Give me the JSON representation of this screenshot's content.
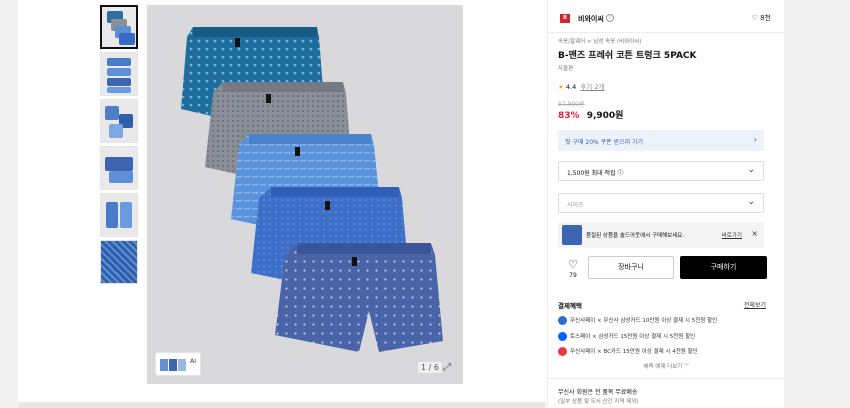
{
  "gallery": {
    "counter": "1 / 6",
    "ai_label": "AI"
  },
  "brand": {
    "logo_text": "B",
    "name": "비와이씨",
    "follow_count": "8천"
  },
  "product": {
    "breadcrumb": "속옷/홈웨어 > 남성 속옷 (비와이씨)",
    "title": "B-맨즈 프레쉬 코튼 트렁크 5PACK",
    "subtitle": "자율편",
    "rating": "4.4",
    "review_count": "후기 2개",
    "original_price": "57,900원",
    "discount": "83%",
    "price": "9,900원"
  },
  "coupon": {
    "text": "첫 구매 20% 쿠폰 받으러 가기"
  },
  "points_select": {
    "value": "1,500원 최대 적립 ⓘ"
  },
  "size_select": {
    "placeholder": "사이즈"
  },
  "banner": {
    "text": "품절된 상품을 솔드아웃에서 구매해보세요.",
    "link": "바로가기"
  },
  "actions": {
    "like_count": "79",
    "cart_label": "장바구니",
    "buy_label": "구매하기"
  },
  "payment": {
    "title": "결제혜택",
    "view_all": "전체보기",
    "rows": [
      "무신사페이 × 무신사 삼성카드 10만원 이상 결제 시 5천원 할인",
      "토스페이 × 삼성카드 15만원 이상 결제 시 5천원 할인",
      "무신사페이 × BC카드 15만원 이상 결제 시 4천원 할인"
    ],
    "more": "혜택 예제 더보기 ﹀"
  },
  "shipping": {
    "line1": "무신사 회원은 전 품목 무료배송",
    "line2": "(일부 상품 및 도서 산간 지역 제외)"
  },
  "colors": {
    "accent_red": "#e0243f",
    "coupon_blue": "#2e5fbf",
    "black_button": "#000000"
  }
}
